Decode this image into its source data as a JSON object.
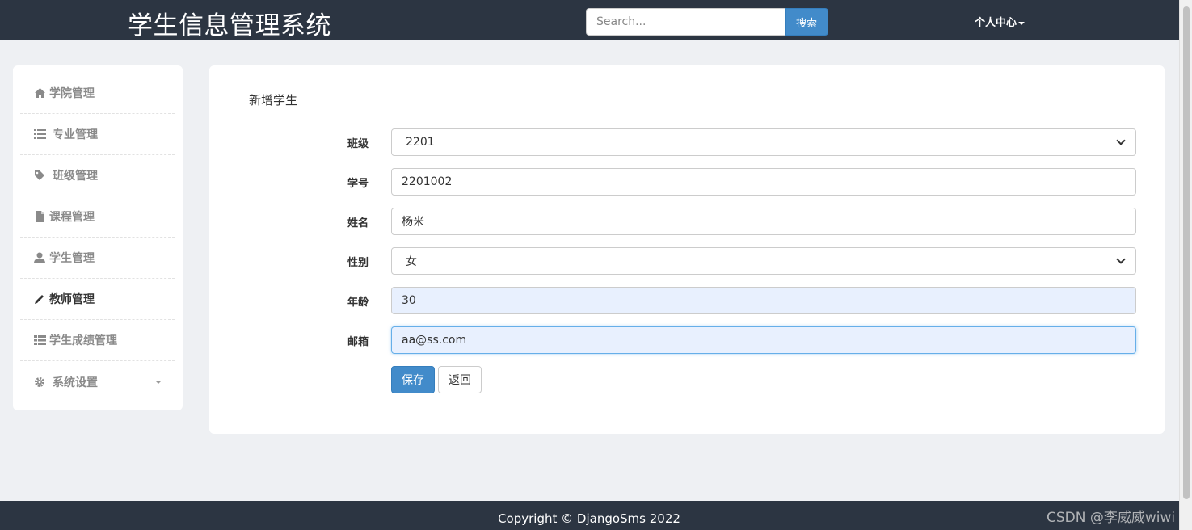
{
  "header": {
    "brand": "学生信息管理系统",
    "search_placeholder": "Search...",
    "search_button": "搜索",
    "user_menu": "个人中心"
  },
  "sidebar": {
    "items": [
      {
        "label": "学院管理",
        "icon": "home-icon"
      },
      {
        "label": "专业管理",
        "icon": "list-icon"
      },
      {
        "label": "班级管理",
        "icon": "tag-icon"
      },
      {
        "label": "课程管理",
        "icon": "file-icon"
      },
      {
        "label": "学生管理",
        "icon": "user-icon"
      },
      {
        "label": "教师管理",
        "icon": "pencil-icon",
        "active": true
      },
      {
        "label": "学生成绩管理",
        "icon": "th-list-icon"
      },
      {
        "label": "系统设置",
        "icon": "gear-icon"
      }
    ]
  },
  "form": {
    "title": "新增学生",
    "fields": {
      "class": {
        "label": "班级",
        "value": "2201"
      },
      "student_id": {
        "label": "学号",
        "value": "2201002"
      },
      "name": {
        "label": "姓名",
        "value": "杨米"
      },
      "gender": {
        "label": "性别",
        "value": "女"
      },
      "age": {
        "label": "年龄",
        "value": "30"
      },
      "email": {
        "label": "邮箱",
        "value": "aa@ss.com"
      }
    },
    "save_label": "保存",
    "back_label": "返回"
  },
  "footer": {
    "copyright": "Copyright © DjangoSms 2022"
  },
  "watermark": "CSDN @李威威wiwi",
  "colors": {
    "navbar": "#2c3542",
    "primary": "#428bca",
    "background": "#eef0f3"
  }
}
